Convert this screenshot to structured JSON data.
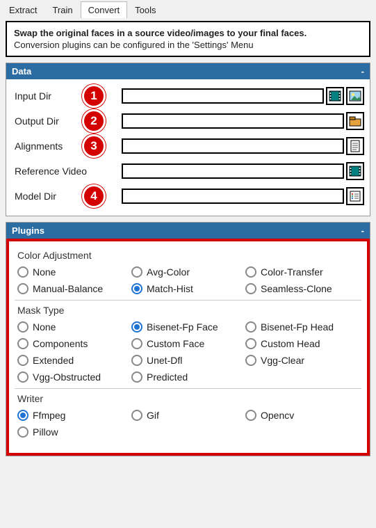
{
  "tabs": {
    "items": [
      "Extract",
      "Train",
      "Convert",
      "Tools"
    ],
    "active_index": 2
  },
  "description": {
    "bold": "Swap the original faces in a source video/images to your final faces.",
    "line": "Conversion plugins can be configured in the 'Settings' Menu"
  },
  "data_section": {
    "title": "Data",
    "collapse": "-",
    "rows": [
      {
        "label": "Input Dir",
        "value": "",
        "icons": [
          "film-icon",
          "image-icon"
        ],
        "marker": "1"
      },
      {
        "label": "Output Dir",
        "value": "",
        "icons": [
          "folder-icon"
        ],
        "marker": "2"
      },
      {
        "label": "Alignments",
        "value": "",
        "icons": [
          "file-icon"
        ],
        "marker": "3"
      },
      {
        "label": "Reference Video",
        "value": "",
        "icons": [
          "film-icon"
        ],
        "marker": null
      },
      {
        "label": "Model Dir",
        "value": "",
        "icons": [
          "list-icon"
        ],
        "marker": "4"
      }
    ]
  },
  "plugins_section": {
    "title": "Plugins",
    "collapse": "-",
    "groups": [
      {
        "label": "Color Adjustment",
        "options": [
          "None",
          "Avg-Color",
          "Color-Transfer",
          "Manual-Balance",
          "Match-Hist",
          "Seamless-Clone"
        ],
        "selected": "Match-Hist"
      },
      {
        "label": "Mask Type",
        "options": [
          "None",
          "Bisenet-Fp Face",
          "Bisenet-Fp Head",
          "Components",
          "Custom Face",
          "Custom Head",
          "Extended",
          "Unet-Dfl",
          "Vgg-Clear",
          "Vgg-Obstructed",
          "Predicted"
        ],
        "selected": "Bisenet-Fp Face"
      },
      {
        "label": "Writer",
        "options": [
          "Ffmpeg",
          "Gif",
          "Opencv",
          "Pillow"
        ],
        "selected": "Ffmpeg"
      }
    ]
  },
  "icons": {
    "film-icon": "teal",
    "image-icon": "skyblue",
    "folder-icon": "#e6a23c",
    "file-icon": "#ddd",
    "list-icon": "#8aa"
  }
}
